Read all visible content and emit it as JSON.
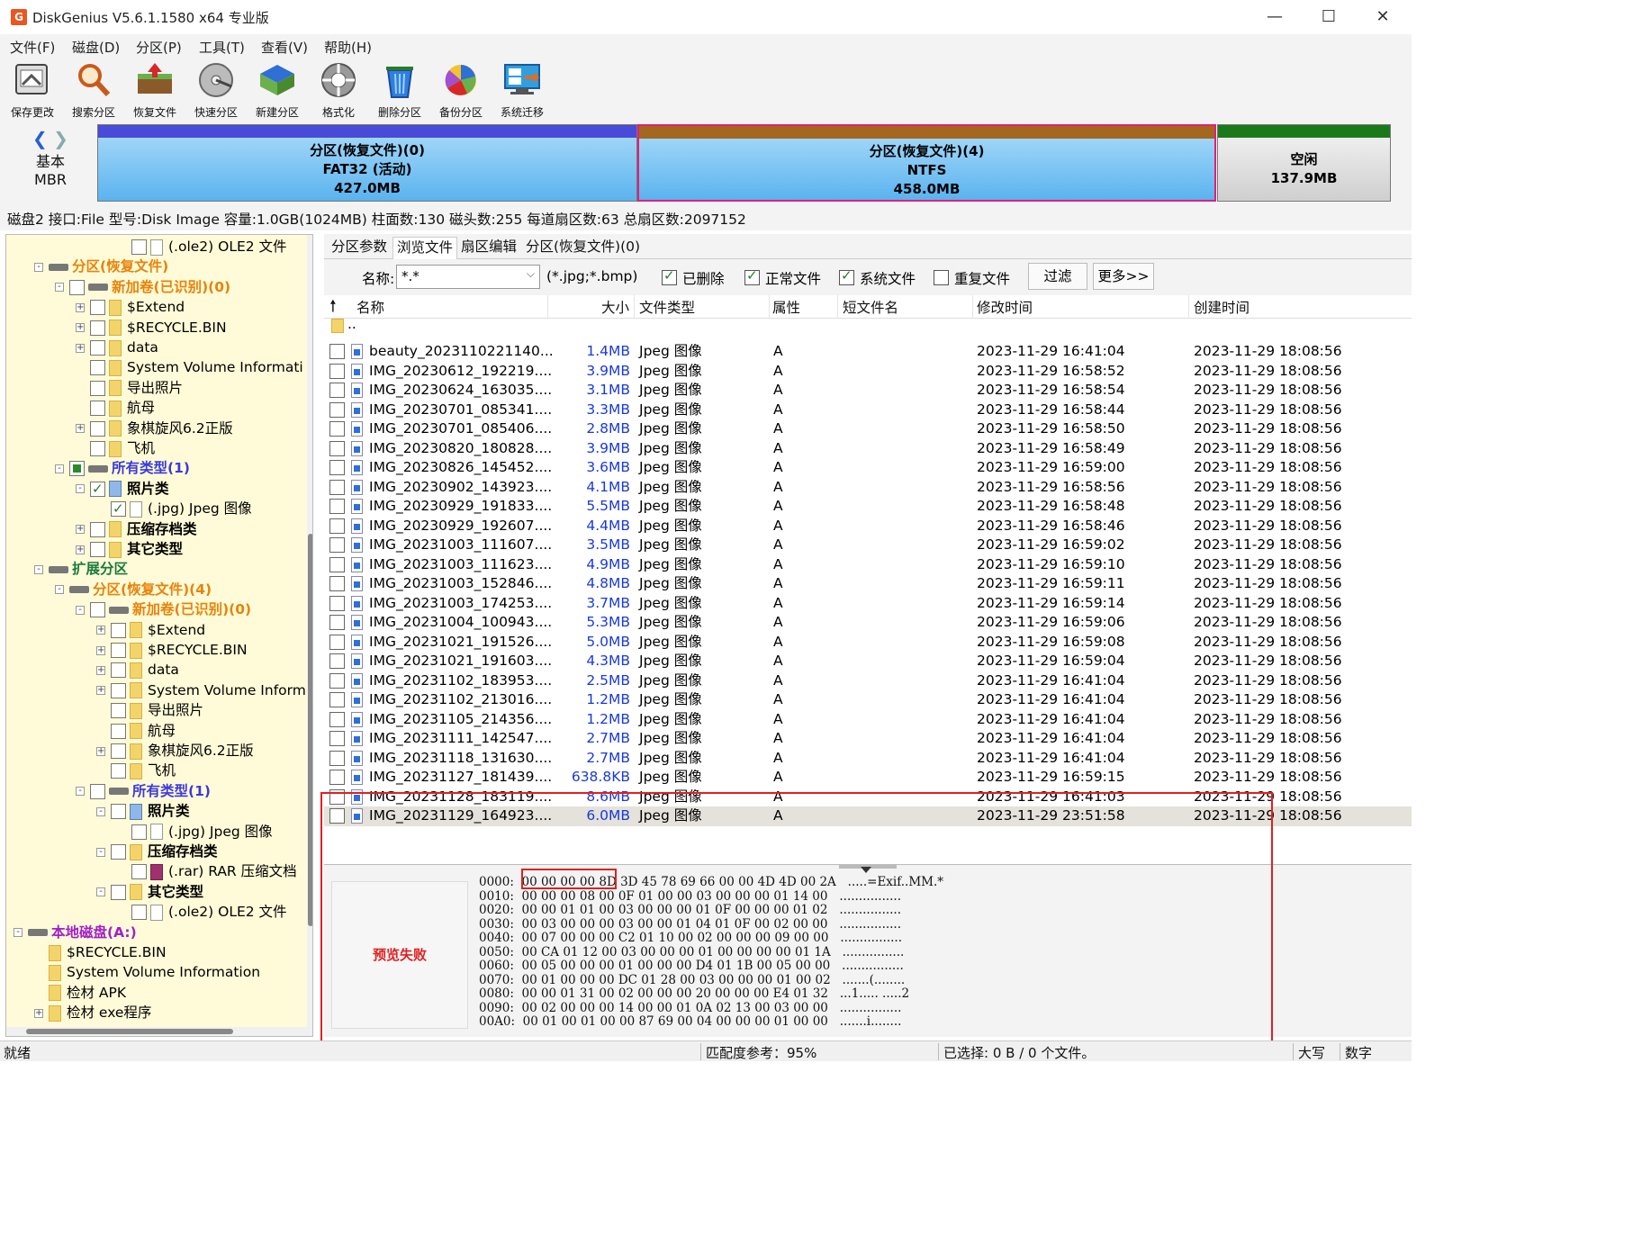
{
  "window": {
    "title": "DiskGenius V5.6.1.1580 x64 专业版",
    "controls": [
      "minimize",
      "maximize",
      "close"
    ]
  },
  "menu": [
    "文件(F)",
    "磁盘(D)",
    "分区(P)",
    "工具(T)",
    "查看(V)",
    "帮助(H)"
  ],
  "toolbar": [
    {
      "label": "保存更改",
      "icon": "save-icon"
    },
    {
      "label": "搜索分区",
      "icon": "search-icon"
    },
    {
      "label": "恢复文件",
      "icon": "recover-files-icon"
    },
    {
      "label": "快速分区",
      "icon": "quick-partition-icon"
    },
    {
      "label": "新建分区",
      "icon": "new-partition-icon"
    },
    {
      "label": "格式化",
      "icon": "format-icon"
    },
    {
      "label": "删除分区",
      "icon": "delete-partition-icon"
    },
    {
      "label": "备份分区",
      "icon": "backup-partition-icon"
    },
    {
      "label": "系统迁移",
      "icon": "system-migration-icon"
    }
  ],
  "disk_map": {
    "type_line1": "基本",
    "type_line2": "MBR",
    "partitions": [
      {
        "name": "分区(恢复文件)(0)",
        "fs": "FAT32 (活动)",
        "size": "427.0MB",
        "color": "#6bb8f0",
        "top_color": "#4a4ad8"
      },
      {
        "name": "分区(恢复文件)(4)",
        "fs": "NTFS",
        "size": "458.0MB",
        "color": "#6bb8f0",
        "top_color": "#a5661e",
        "selected": true
      },
      {
        "name": "空闲",
        "fs": "",
        "size": "137.9MB",
        "color": "#d8d8d8",
        "top_color": "#1a7a1a"
      }
    ]
  },
  "disk_info": "磁盘2 接口:File  型号:Disk Image  容量:1.0GB(1024MB)  柱面数:130  磁头数:255  每道扇区数:63  总扇区数:2097152",
  "tree": [
    {
      "indent": 5,
      "chk": "off",
      "icon": "doc",
      "text": "(.ole2) OLE2 文件",
      "style": ""
    },
    {
      "indent": 1,
      "exp": "-",
      "chk": "none",
      "icon": "drv",
      "text": "分区(恢复文件)",
      "style": "orange"
    },
    {
      "indent": 2,
      "exp": "-",
      "chk": "off",
      "icon": "drv",
      "text": "新加卷(已识别)(0)",
      "style": "orange"
    },
    {
      "indent": 3,
      "exp": "+",
      "chk": "off",
      "icon": "fld",
      "text": "$Extend",
      "style": ""
    },
    {
      "indent": 3,
      "exp": "+",
      "chk": "off",
      "icon": "fld",
      "text": "$RECYCLE.BIN",
      "style": ""
    },
    {
      "indent": 3,
      "exp": "+",
      "chk": "off",
      "icon": "fld",
      "text": "data",
      "style": ""
    },
    {
      "indent": 3,
      "exp": "",
      "chk": "off",
      "icon": "fld",
      "text": "System Volume Informati",
      "style": ""
    },
    {
      "indent": 3,
      "exp": "",
      "chk": "off",
      "icon": "fld",
      "text": "导出照片",
      "style": ""
    },
    {
      "indent": 3,
      "exp": "",
      "chk": "off",
      "icon": "fld",
      "text": "航母",
      "style": ""
    },
    {
      "indent": 3,
      "exp": "+",
      "chk": "off",
      "icon": "fld",
      "text": "象棋旋风6.2正版",
      "style": ""
    },
    {
      "indent": 3,
      "exp": "",
      "chk": "off",
      "icon": "fld",
      "text": "飞机",
      "style": ""
    },
    {
      "indent": 2,
      "exp": "-",
      "chk": "part-on",
      "icon": "drv",
      "text": "所有类型(1)",
      "style": "blue"
    },
    {
      "indent": 3,
      "exp": "-",
      "chk": "on",
      "icon": "img",
      "text": "照片类",
      "style": "bold"
    },
    {
      "indent": 4,
      "exp": "",
      "chk": "on",
      "icon": "doc",
      "text": "(.jpg) Jpeg 图像",
      "style": ""
    },
    {
      "indent": 3,
      "exp": "+",
      "chk": "off",
      "icon": "fld",
      "text": "压缩存档类",
      "style": "bold"
    },
    {
      "indent": 3,
      "exp": "+",
      "chk": "off",
      "icon": "fld",
      "text": "其它类型",
      "style": "bold"
    },
    {
      "indent": 1,
      "exp": "-",
      "chk": "none",
      "icon": "drv",
      "text": "扩展分区",
      "style": "green"
    },
    {
      "indent": 2,
      "exp": "-",
      "chk": "none",
      "icon": "drv",
      "text": "分区(恢复文件)(4)",
      "style": "orange"
    },
    {
      "indent": 3,
      "exp": "-",
      "chk": "off",
      "icon": "drv",
      "text": "新加卷(已识别)(0)",
      "style": "orange"
    },
    {
      "indent": 4,
      "exp": "+",
      "chk": "off",
      "icon": "fld",
      "text": "$Extend",
      "style": ""
    },
    {
      "indent": 4,
      "exp": "+",
      "chk": "off",
      "icon": "fld",
      "text": "$RECYCLE.BIN",
      "style": ""
    },
    {
      "indent": 4,
      "exp": "+",
      "chk": "off",
      "icon": "fld",
      "text": "data",
      "style": ""
    },
    {
      "indent": 4,
      "exp": "+",
      "chk": "off",
      "icon": "fld",
      "text": "System Volume Inform",
      "style": ""
    },
    {
      "indent": 4,
      "exp": "",
      "chk": "off",
      "icon": "fld",
      "text": "导出照片",
      "style": ""
    },
    {
      "indent": 4,
      "exp": "",
      "chk": "off",
      "icon": "fld",
      "text": "航母",
      "style": ""
    },
    {
      "indent": 4,
      "exp": "+",
      "chk": "off",
      "icon": "fld",
      "text": "象棋旋风6.2正版",
      "style": ""
    },
    {
      "indent": 4,
      "exp": "",
      "chk": "off",
      "icon": "fld",
      "text": "飞机",
      "style": ""
    },
    {
      "indent": 3,
      "exp": "-",
      "chk": "off",
      "icon": "drv",
      "text": "所有类型(1)",
      "style": "blue"
    },
    {
      "indent": 4,
      "exp": "-",
      "chk": "off",
      "icon": "img",
      "text": "照片类",
      "style": "bold"
    },
    {
      "indent": 5,
      "exp": "",
      "chk": "off",
      "icon": "doc",
      "text": "(.jpg) Jpeg 图像",
      "style": ""
    },
    {
      "indent": 4,
      "exp": "-",
      "chk": "off",
      "icon": "fld",
      "text": "压缩存档类",
      "style": "bold"
    },
    {
      "indent": 5,
      "exp": "",
      "chk": "off",
      "icon": "rar",
      "text": "(.rar) RAR 压缩文档",
      "style": ""
    },
    {
      "indent": 4,
      "exp": "-",
      "chk": "off",
      "icon": "fld",
      "text": "其它类型",
      "style": "bold"
    },
    {
      "indent": 5,
      "exp": "",
      "chk": "off",
      "icon": "doc",
      "text": "(.ole2) OLE2 文件",
      "style": ""
    },
    {
      "indent": 0,
      "exp": "-",
      "chk": "none",
      "icon": "drv",
      "text": "本地磁盘(A:)",
      "style": "purple"
    },
    {
      "indent": 1,
      "exp": "",
      "chk": "none",
      "icon": "fld",
      "text": "$RECYCLE.BIN",
      "style": ""
    },
    {
      "indent": 1,
      "exp": "",
      "chk": "none",
      "icon": "fld",
      "text": "System Volume Information",
      "style": ""
    },
    {
      "indent": 1,
      "exp": "",
      "chk": "none",
      "icon": "fld",
      "text": "检材 APK",
      "style": ""
    },
    {
      "indent": 1,
      "exp": "+",
      "chk": "none",
      "icon": "fld",
      "text": "检材 exe程序",
      "style": ""
    }
  ],
  "tabs": [
    "分区参数",
    "浏览文件",
    "扇区编辑",
    "分区(恢复文件)(0)"
  ],
  "active_tab": 1,
  "filter": {
    "name_label": "名称:",
    "name_value": "*.*",
    "hint": "(*.jpg;*.bmp)",
    "checks": [
      {
        "label": "已删除",
        "checked": true
      },
      {
        "label": "正常文件",
        "checked": true
      },
      {
        "label": "系统文件",
        "checked": true
      },
      {
        "label": "重复文件",
        "checked": false
      }
    ],
    "filter_button": "过滤",
    "more_button": "更多>>"
  },
  "columns": [
    "名称",
    "大小",
    "文件类型",
    "属性",
    "短文件名",
    "修改时间",
    "创建时间"
  ],
  "parent_entry": "..",
  "files": [
    {
      "name": "beauty_2023110221140...",
      "size": "1.4MB",
      "type": "Jpeg 图像",
      "attr": "A",
      "modified": "2023-11-29 16:41:04",
      "created": "2023-11-29 18:08:56"
    },
    {
      "name": "IMG_20230612_192219....",
      "size": "3.9MB",
      "type": "Jpeg 图像",
      "attr": "A",
      "modified": "2023-11-29 16:58:52",
      "created": "2023-11-29 18:08:56"
    },
    {
      "name": "IMG_20230624_163035....",
      "size": "3.1MB",
      "type": "Jpeg 图像",
      "attr": "A",
      "modified": "2023-11-29 16:58:54",
      "created": "2023-11-29 18:08:56"
    },
    {
      "name": "IMG_20230701_085341....",
      "size": "3.3MB",
      "type": "Jpeg 图像",
      "attr": "A",
      "modified": "2023-11-29 16:58:44",
      "created": "2023-11-29 18:08:56"
    },
    {
      "name": "IMG_20230701_085406....",
      "size": "2.8MB",
      "type": "Jpeg 图像",
      "attr": "A",
      "modified": "2023-11-29 16:58:50",
      "created": "2023-11-29 18:08:56"
    },
    {
      "name": "IMG_20230820_180828....",
      "size": "3.9MB",
      "type": "Jpeg 图像",
      "attr": "A",
      "modified": "2023-11-29 16:58:49",
      "created": "2023-11-29 18:08:56"
    },
    {
      "name": "IMG_20230826_145452....",
      "size": "3.6MB",
      "type": "Jpeg 图像",
      "attr": "A",
      "modified": "2023-11-29 16:59:00",
      "created": "2023-11-29 18:08:56"
    },
    {
      "name": "IMG_20230902_143923....",
      "size": "4.1MB",
      "type": "Jpeg 图像",
      "attr": "A",
      "modified": "2023-11-29 16:58:56",
      "created": "2023-11-29 18:08:56"
    },
    {
      "name": "IMG_20230929_191833....",
      "size": "5.5MB",
      "type": "Jpeg 图像",
      "attr": "A",
      "modified": "2023-11-29 16:58:48",
      "created": "2023-11-29 18:08:56"
    },
    {
      "name": "IMG_20230929_192607....",
      "size": "4.4MB",
      "type": "Jpeg 图像",
      "attr": "A",
      "modified": "2023-11-29 16:58:46",
      "created": "2023-11-29 18:08:56"
    },
    {
      "name": "IMG_20231003_111607....",
      "size": "3.5MB",
      "type": "Jpeg 图像",
      "attr": "A",
      "modified": "2023-11-29 16:59:02",
      "created": "2023-11-29 18:08:56"
    },
    {
      "name": "IMG_20231003_111623....",
      "size": "4.9MB",
      "type": "Jpeg 图像",
      "attr": "A",
      "modified": "2023-11-29 16:59:10",
      "created": "2023-11-29 18:08:56"
    },
    {
      "name": "IMG_20231003_152846....",
      "size": "4.8MB",
      "type": "Jpeg 图像",
      "attr": "A",
      "modified": "2023-11-29 16:59:11",
      "created": "2023-11-29 18:08:56"
    },
    {
      "name": "IMG_20231003_174253....",
      "size": "3.7MB",
      "type": "Jpeg 图像",
      "attr": "A",
      "modified": "2023-11-29 16:59:14",
      "created": "2023-11-29 18:08:56"
    },
    {
      "name": "IMG_20231004_100943....",
      "size": "5.3MB",
      "type": "Jpeg 图像",
      "attr": "A",
      "modified": "2023-11-29 16:59:06",
      "created": "2023-11-29 18:08:56"
    },
    {
      "name": "IMG_20231021_191526....",
      "size": "5.0MB",
      "type": "Jpeg 图像",
      "attr": "A",
      "modified": "2023-11-29 16:59:08",
      "created": "2023-11-29 18:08:56"
    },
    {
      "name": "IMG_20231021_191603....",
      "size": "4.3MB",
      "type": "Jpeg 图像",
      "attr": "A",
      "modified": "2023-11-29 16:59:04",
      "created": "2023-11-29 18:08:56"
    },
    {
      "name": "IMG_20231102_183953....",
      "size": "2.5MB",
      "type": "Jpeg 图像",
      "attr": "A",
      "modified": "2023-11-29 16:41:04",
      "created": "2023-11-29 18:08:56"
    },
    {
      "name": "IMG_20231102_213016....",
      "size": "1.2MB",
      "type": "Jpeg 图像",
      "attr": "A",
      "modified": "2023-11-29 16:41:04",
      "created": "2023-11-29 18:08:56"
    },
    {
      "name": "IMG_20231105_214356....",
      "size": "1.2MB",
      "type": "Jpeg 图像",
      "attr": "A",
      "modified": "2023-11-29 16:41:04",
      "created": "2023-11-29 18:08:56"
    },
    {
      "name": "IMG_20231111_142547....",
      "size": "2.7MB",
      "type": "Jpeg 图像",
      "attr": "A",
      "modified": "2023-11-29 16:41:04",
      "created": "2023-11-29 18:08:56"
    },
    {
      "name": "IMG_20231118_131630....",
      "size": "2.7MB",
      "type": "Jpeg 图像",
      "attr": "A",
      "modified": "2023-11-29 16:41:04",
      "created": "2023-11-29 18:08:56"
    },
    {
      "name": "IMG_20231127_181439....",
      "size": "638.8KB",
      "type": "Jpeg 图像",
      "attr": "A",
      "modified": "2023-11-29 16:59:15",
      "created": "2023-11-29 18:08:56"
    },
    {
      "name": "IMG_20231128_183119....",
      "size": "8.6MB",
      "type": "Jpeg 图像",
      "attr": "A",
      "modified": "2023-11-29 16:41:03",
      "created": "2023-11-29 18:08:56"
    },
    {
      "name": "IMG_20231129_164923....",
      "size": "6.0MB",
      "type": "Jpeg 图像",
      "attr": "A",
      "modified": "2023-11-29 23:51:58",
      "created": "2023-11-29 18:08:56",
      "selected": true
    }
  ],
  "preview_failed": "预览失败",
  "hex_lines": [
    "0000:  00 00 00 00 8D 3D 45 78 69 66 00 00 4D 4D 00 2A   .....=Exif..MM.*",
    "0010:  00 00 00 08 00 0F 01 00 00 03 00 00 00 01 14 00   ................",
    "0020:  00 00 01 01 00 03 00 00 00 01 0F 00 00 00 01 02   ................",
    "0030:  00 03 00 00 00 03 00 00 01 04 01 0F 00 02 00 00   ................",
    "0040:  00 07 00 00 00 C2 01 10 00 02 00 00 00 09 00 00   ................",
    "0050:  00 CA 01 12 00 03 00 00 00 01 00 00 00 00 01 1A   ................",
    "0060:  00 05 00 00 00 01 00 00 00 D4 01 1B 00 05 00 00   ................",
    "0070:  00 01 00 00 00 DC 01 28 00 03 00 00 00 01 00 02   .......(........",
    "0080:  00 00 01 31 00 02 00 00 00 20 00 00 00 E4 01 32   ...1..... .....2",
    "0090:  00 02 00 00 00 14 00 00 01 0A 02 13 00 03 00 00   ................",
    "00A0:  00 01 00 01 00 00 87 69 00 04 00 00 00 01 00 00   .......i........"
  ],
  "status": {
    "left": "就绪",
    "match": "匹配度参考：95%",
    "selected": "已选择: 0 B / 0 个文件。",
    "caps": "大写",
    "num": "数字"
  }
}
